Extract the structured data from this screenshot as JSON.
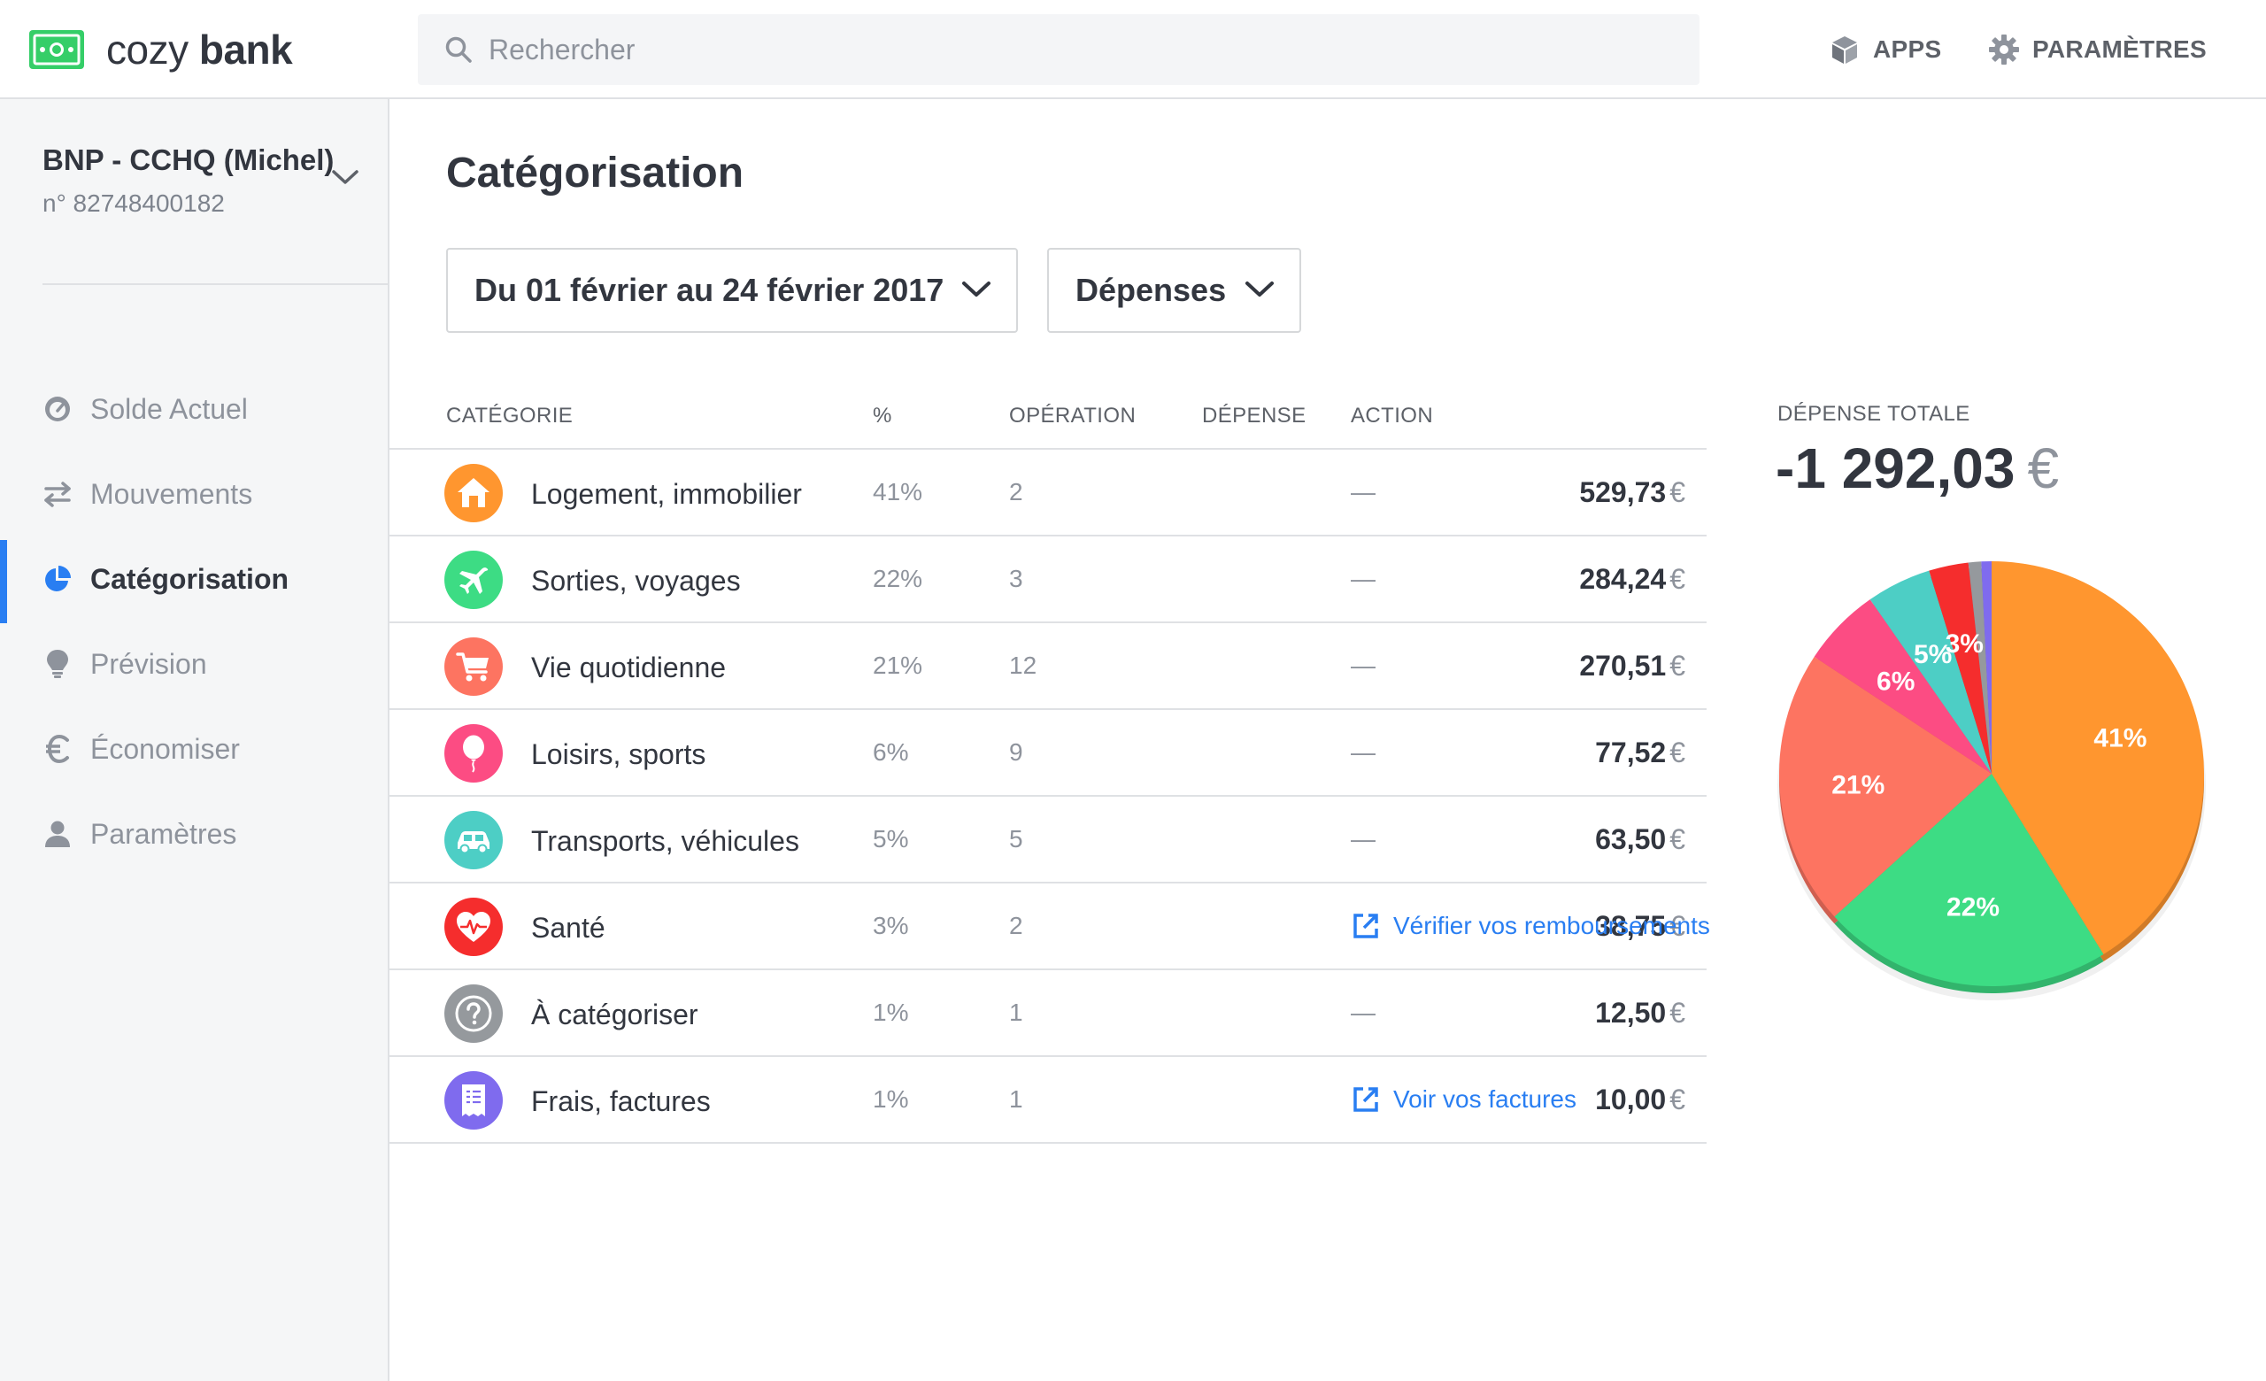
{
  "app": {
    "brand_light": "cozy",
    "brand_bold": "bank",
    "search_placeholder": "Rechercher",
    "apps_label": "APPS",
    "settings_label": "PARAMÈTRES"
  },
  "account": {
    "name": "BNP - CCHQ (Michel)",
    "number": "n° 82748400182"
  },
  "nav": [
    {
      "label": "Solde Actuel",
      "icon": "gauge-icon",
      "active": false
    },
    {
      "label": "Mouvements",
      "icon": "transfer-arrows-icon",
      "active": false
    },
    {
      "label": "Catégorisation",
      "icon": "pie-chart-icon",
      "active": true
    },
    {
      "label": "Prévision",
      "icon": "lightbulb-icon",
      "active": false
    },
    {
      "label": "Économiser",
      "icon": "euro-icon",
      "active": false
    },
    {
      "label": "Paramètres",
      "icon": "user-icon",
      "active": false
    }
  ],
  "page": {
    "title": "Catégorisation",
    "date_filter": "Du 01 février au 24 février 2017",
    "type_filter": "Dépenses"
  },
  "table": {
    "headers": {
      "category": "Catégorie",
      "percent": "%",
      "operation": "Opération",
      "expense": "Dépense",
      "action": "Action"
    },
    "currency": "€",
    "rows": [
      {
        "category": "Logement, immobilier",
        "icon": "house-icon",
        "color": "#ff962f",
        "percent": "41%",
        "operations": "2",
        "amount": "529,73",
        "action": "—",
        "action_link": false
      },
      {
        "category": "Sorties, voyages",
        "icon": "airplane-icon",
        "color": "#3ddc84",
        "percent": "22%",
        "operations": "3",
        "amount": "284,24",
        "action": "—",
        "action_link": false
      },
      {
        "category": "Vie quotidienne",
        "icon": "shopping-cart-icon",
        "color": "#fd7461",
        "percent": "21%",
        "operations": "12",
        "amount": "270,51",
        "action": "—",
        "action_link": false
      },
      {
        "category": "Loisirs, sports",
        "icon": "balloon-icon",
        "color": "#fc4c83",
        "percent": "6%",
        "operations": "9",
        "amount": "77,52",
        "action": "—",
        "action_link": false
      },
      {
        "category": "Transports, véhicules",
        "icon": "car-icon",
        "color": "#4dcec5",
        "percent": "5%",
        "operations": "5",
        "amount": "63,50",
        "action": "—",
        "action_link": false
      },
      {
        "category": "Santé",
        "icon": "heart-pulse-icon",
        "color": "#f52d2d",
        "percent": "3%",
        "operations": "2",
        "amount": "38,75",
        "action": "Vérifier vos remboursements",
        "action_link": true
      },
      {
        "category": "À catégoriser",
        "icon": "question-icon",
        "color": "#95999d",
        "percent": "1%",
        "operations": "1",
        "amount": "12,50",
        "action": "—",
        "action_link": false
      },
      {
        "category": "Frais, factures",
        "icon": "receipt-icon",
        "color": "#7f6bee",
        "percent": "1%",
        "operations": "1",
        "amount": "10,00",
        "action": "Voir vos factures",
        "action_link": true
      }
    ]
  },
  "total": {
    "label": "DÉPENSE TOTALE",
    "amount": "-1 292,03",
    "currency": "€"
  },
  "chart_data": {
    "type": "pie",
    "slices": [
      {
        "name": "Logement, immobilier",
        "value": 529.73,
        "label": "41%",
        "color": "#ff962f"
      },
      {
        "name": "Sorties, voyages",
        "value": 284.24,
        "label": "22%",
        "color": "#3ddc84"
      },
      {
        "name": "Vie quotidienne",
        "value": 270.51,
        "label": "21%",
        "color": "#fd7461"
      },
      {
        "name": "Loisirs, sports",
        "value": 77.52,
        "label": "6%",
        "color": "#fc4c83"
      },
      {
        "name": "Transports, véhicules",
        "value": 63.5,
        "label": "5%",
        "color": "#4dcec5"
      },
      {
        "name": "Santé",
        "value": 38.75,
        "label": "3%",
        "color": "#f52d2d"
      },
      {
        "name": "À catégoriser",
        "value": 12.5,
        "label": "",
        "color": "#95999d"
      },
      {
        "name": "Frais, factures",
        "value": 10.0,
        "label": "",
        "color": "#7f6bee"
      }
    ]
  },
  "colors": {
    "accent": "#297ef2",
    "brand_green": "#35ce68"
  }
}
